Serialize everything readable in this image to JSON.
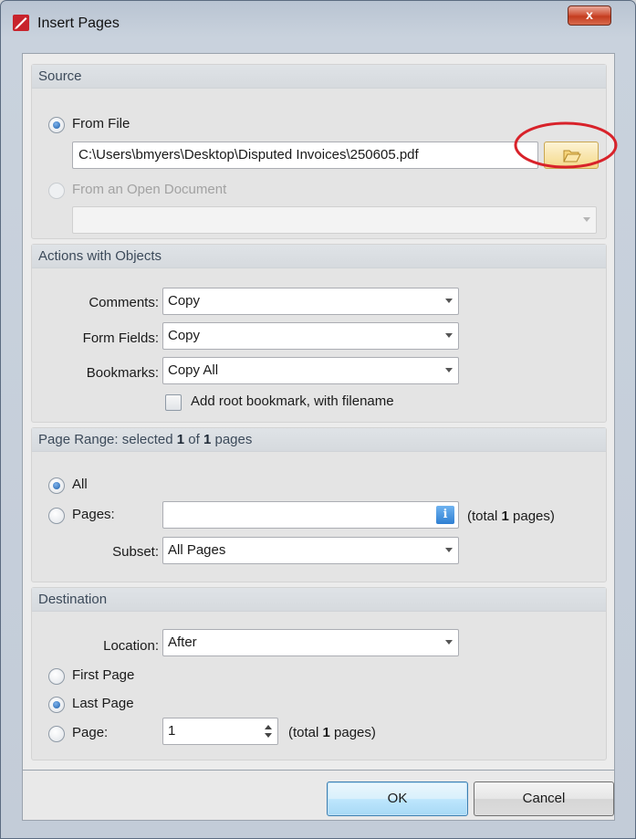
{
  "window": {
    "title": "Insert Pages",
    "close_label": "x"
  },
  "source": {
    "header": "Source",
    "from_file_label": "From File",
    "file_path": "C:\\Users\\bmyers\\Desktop\\Disputed Invoices\\250605.pdf",
    "from_open_doc_label": "From an Open Document",
    "open_doc_value": "",
    "selected": "from_file"
  },
  "actions": {
    "header": "Actions with Objects",
    "comments_label": "Comments:",
    "comments_value": "Copy",
    "form_fields_label": "Form Fields:",
    "form_fields_value": "Copy",
    "bookmarks_label": "Bookmarks:",
    "bookmarks_value": "Copy All",
    "add_root_bookmark_label": "Add root bookmark, with filename",
    "add_root_bookmark_checked": false
  },
  "page_range": {
    "header_prefix": "Page Range: selected ",
    "header_selected": "1",
    "header_mid": " of ",
    "header_total": "1",
    "header_suffix": " pages",
    "all_label": "All",
    "pages_label": "Pages:",
    "pages_value": "",
    "total_prefix": "(total ",
    "total_count": "1",
    "total_suffix": " pages)",
    "subset_label": "Subset:",
    "subset_value": "All Pages",
    "selected": "all"
  },
  "destination": {
    "header": "Destination",
    "location_label": "Location:",
    "location_value": "After",
    "first_page_label": "First Page",
    "last_page_label": "Last Page",
    "page_label": "Page:",
    "page_value": "1",
    "total_prefix": "(total ",
    "total_count": "1",
    "total_suffix": " pages)",
    "selected": "last_page"
  },
  "buttons": {
    "ok": "OK",
    "cancel": "Cancel"
  },
  "colors": {
    "highlight_annotation": "#d8222a",
    "accent_radio": "#1c5ea8",
    "browse_button": "#f4d98a"
  }
}
